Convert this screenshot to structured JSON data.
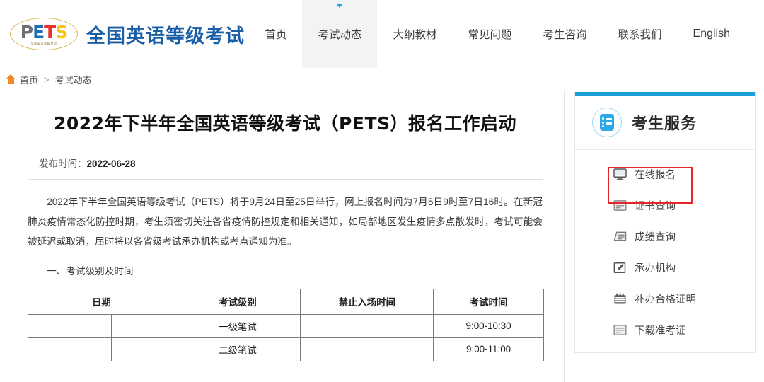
{
  "header": {
    "logo": {
      "letters": [
        "P",
        "E",
        "T",
        "S"
      ],
      "subtext": "全国英语等级考试",
      "icon": "pets-logo-icon"
    },
    "site_title": "全国英语等级考试",
    "nav": [
      {
        "label": "首页",
        "active": false
      },
      {
        "label": "考试动态",
        "active": true
      },
      {
        "label": "大纲教材",
        "active": false
      },
      {
        "label": "常见问题",
        "active": false
      },
      {
        "label": "考生咨询",
        "active": false
      },
      {
        "label": "联系我们",
        "active": false
      },
      {
        "label": "English",
        "active": false
      }
    ]
  },
  "breadcrumb": {
    "home_icon": "home-icon",
    "home": "首页",
    "separator": ">",
    "current": "考试动态"
  },
  "article": {
    "title": "2022年下半年全国英语等级考试（PETS）报名工作启动",
    "meta_label": "发布时间：",
    "meta_date": "2022-06-28",
    "paragraph": "2022年下半年全国英语等级考试（PETS）将于9月24日至25日举行，网上报名时间为7月5日9时至7日16时。在新冠肺炎疫情常态化防控时期，考生须密切关注各省疫情防控规定和相关通知，如局部地区发生疫情多点散发时，考试可能会被延迟或取消，届时将以各省级考试承办机构或考点通知为准。",
    "section_heading": "一、考试级别及时间",
    "table": {
      "headers": [
        "日期",
        "考试级别",
        "禁止入场时间",
        "考试时间"
      ],
      "rows": [
        {
          "date_a": "",
          "date_b": "",
          "level": "一级笔试",
          "ban_time": "",
          "exam_time": "9:00-10:30"
        },
        {
          "date_a": "",
          "date_b": "",
          "level": "二级笔试",
          "ban_time": "",
          "exam_time": "9:00-11:00"
        }
      ]
    }
  },
  "sidebar": {
    "title": "考生服务",
    "title_icon": "id-card-icon",
    "accent_color": "#1a9fd9",
    "highlight_color": "#e7262b",
    "items": [
      {
        "label": "在线报名",
        "icon": "monitor-icon",
        "highlighted": true
      },
      {
        "label": "证书查询",
        "icon": "certificate-icon",
        "highlighted": false
      },
      {
        "label": "成绩查询",
        "icon": "score-document-icon",
        "highlighted": false
      },
      {
        "label": "承办机构",
        "icon": "pencil-square-icon",
        "highlighted": false
      },
      {
        "label": "补办合格证明",
        "icon": "calendar-stamp-icon",
        "highlighted": false
      },
      {
        "label": "下载准考证",
        "icon": "download-card-icon",
        "highlighted": false
      }
    ]
  }
}
